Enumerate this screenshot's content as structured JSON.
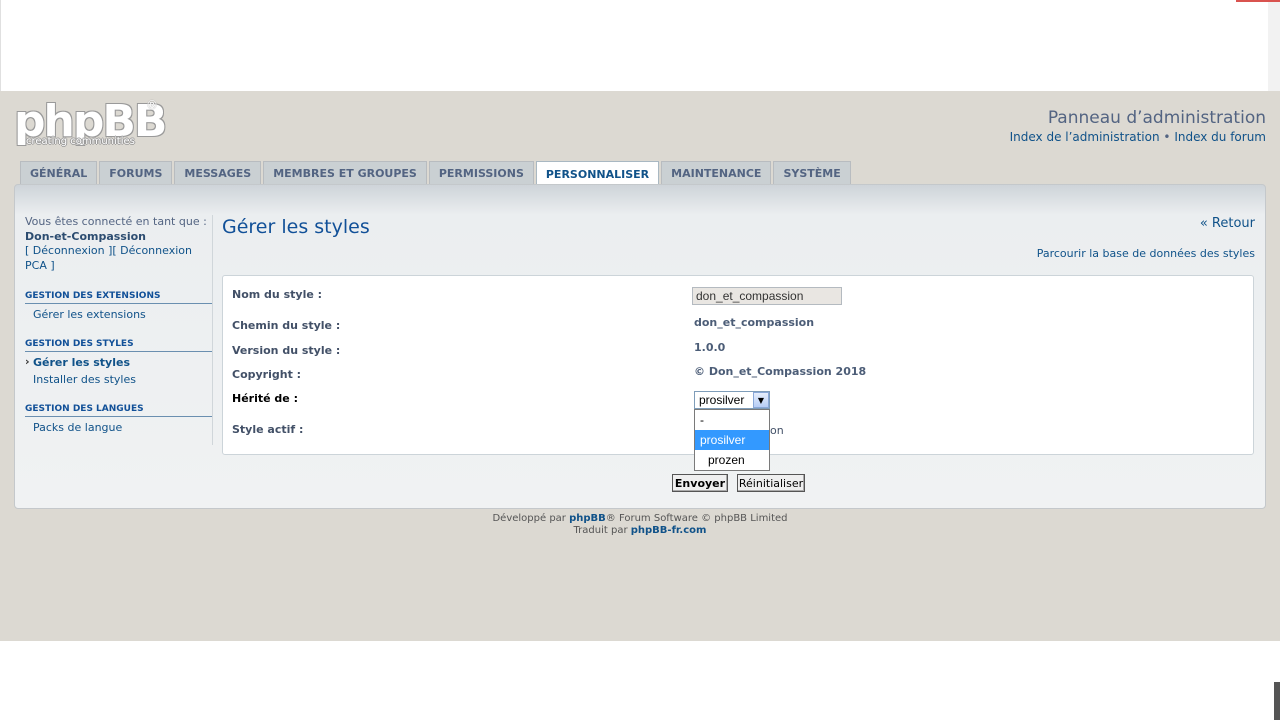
{
  "header": {
    "logo_word": "phpBB",
    "logo_reg": "®",
    "logo_tagline": "creating communities",
    "title": "Panneau d’administration",
    "links": [
      "Index de l’administration",
      "Index du forum"
    ],
    "link_separator": " • "
  },
  "tabs": [
    {
      "label": "Général"
    },
    {
      "label": "Forums"
    },
    {
      "label": "Messages"
    },
    {
      "label": "Membres et groupes"
    },
    {
      "label": "Permissions"
    },
    {
      "label": "Personnaliser",
      "active": true
    },
    {
      "label": "Maintenance"
    },
    {
      "label": "Système"
    }
  ],
  "sidebar": {
    "login_prefix": "Vous êtes connecté en tant que :",
    "username": "Don-et-Compassion",
    "logout_links": "[ Déconnexion ][ Déconnexion PCA ]",
    "sections": [
      {
        "heading": "Gestion des extensions",
        "items": [
          {
            "label": "Gérer les extensions"
          }
        ]
      },
      {
        "heading": "Gestion des styles",
        "items": [
          {
            "label": "Gérer les styles",
            "active": true
          },
          {
            "label": "Installer des styles"
          }
        ]
      },
      {
        "heading": "Gestion des langues",
        "items": [
          {
            "label": "Packs de langue"
          }
        ]
      }
    ]
  },
  "content": {
    "title": "Gérer les styles",
    "back_link": "« Retour",
    "browse_link": "Parcourir la base de données des styles",
    "form": {
      "style_name_label": "Nom du style :",
      "style_name_value": "don_et_compassion",
      "style_path_label": "Chemin du style :",
      "style_path_value": "don_et_compassion",
      "style_version_label": "Version du style :",
      "style_version_value": "1.0.0",
      "copyright_label": "Copyright :",
      "copyright_value": "© Don_et_Compassion 2018",
      "inherits_label": "Hérité de :",
      "inherits_selected": "prosilver",
      "inherits_options": [
        "-",
        "prosilver",
        "prozen"
      ],
      "active_label": "Style actif :",
      "active_partial": "on"
    },
    "submit_label": "Envoyer",
    "reset_label": "Réinitialiser"
  },
  "footer": {
    "line1_prefix": "Développé par ",
    "line1_link": "phpBB",
    "line1_suffix": "® Forum Software © phpBB Limited",
    "line2_prefix": "Traduit par ",
    "line2_link": "phpBB-fr.com"
  },
  "colors": {
    "page_bg": "#dcd9d2",
    "link": "#105289",
    "heading": "#115098",
    "selected_option": "#3399ff"
  }
}
